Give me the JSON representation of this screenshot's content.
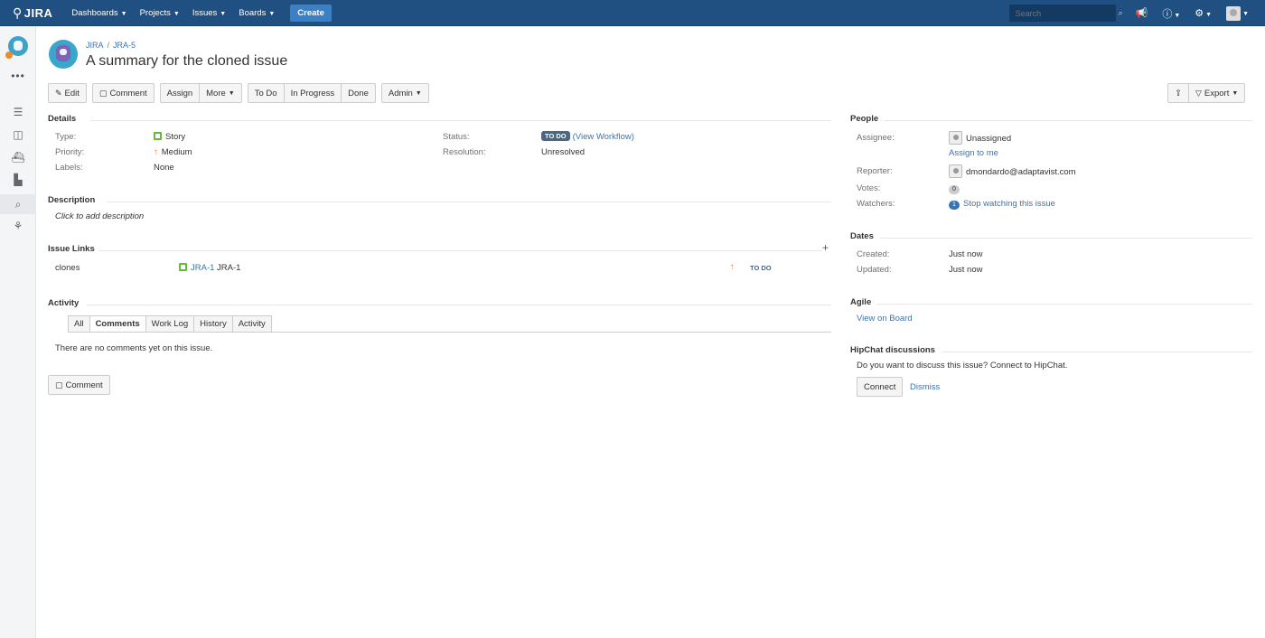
{
  "topnav": {
    "logo_text": "JIRA",
    "menus": [
      {
        "label": "Dashboards"
      },
      {
        "label": "Projects"
      },
      {
        "label": "Issues"
      },
      {
        "label": "Boards"
      }
    ],
    "create_label": "Create",
    "search_placeholder": "Search"
  },
  "issue": {
    "breadcrumb_project": "JIRA",
    "breadcrumb_key": "JRA-5",
    "title": "A summary for the cloned issue"
  },
  "toolbar": {
    "edit": "Edit",
    "comment": "Comment",
    "assign": "Assign",
    "more": "More",
    "todo": "To Do",
    "in_progress": "In Progress",
    "done": "Done",
    "admin": "Admin",
    "export": "Export"
  },
  "details": {
    "heading": "Details",
    "type_label": "Type:",
    "type_value": "Story",
    "priority_label": "Priority:",
    "priority_value": "Medium",
    "labels_label": "Labels:",
    "labels_value": "None",
    "status_label": "Status:",
    "status_value": "TO DO",
    "view_workflow": "(View Workflow)",
    "resolution_label": "Resolution:",
    "resolution_value": "Unresolved"
  },
  "description": {
    "heading": "Description",
    "placeholder": "Click to add description"
  },
  "issue_links": {
    "heading": "Issue Links",
    "relation": "clones",
    "linked_key": "JRA-1",
    "linked_summary": "JRA-1",
    "linked_status": "TO DO"
  },
  "activity": {
    "heading": "Activity",
    "tabs": [
      "All",
      "Comments",
      "Work Log",
      "History",
      "Activity"
    ],
    "active_tab": "Comments",
    "empty_text": "There are no comments yet on this issue.",
    "comment_button": "Comment"
  },
  "people": {
    "heading": "People",
    "assignee_label": "Assignee:",
    "assignee_value": "Unassigned",
    "assign_to_me": "Assign to me",
    "reporter_label": "Reporter:",
    "reporter_value": "dmondardo@adaptavist.com",
    "votes_label": "Votes:",
    "votes_count": "0",
    "watchers_label": "Watchers:",
    "watchers_count": "1",
    "watch_link": "Stop watching this issue"
  },
  "dates": {
    "heading": "Dates",
    "created_label": "Created:",
    "created_value": "Just now",
    "updated_label": "Updated:",
    "updated_value": "Just now"
  },
  "agile": {
    "heading": "Agile",
    "view_on_board": "View on Board"
  },
  "hipchat": {
    "heading": "HipChat discussions",
    "prompt": "Do you want to discuss this issue? Connect to HipChat.",
    "connect": "Connect",
    "dismiss": "Dismiss"
  },
  "colors": {
    "header_bg": "#205081",
    "create_bg": "#3b7fc4",
    "link": "#3b73af",
    "status_todo": "#4a6785",
    "story_green": "#63ba3c",
    "priority_orange": "#f0782a"
  }
}
